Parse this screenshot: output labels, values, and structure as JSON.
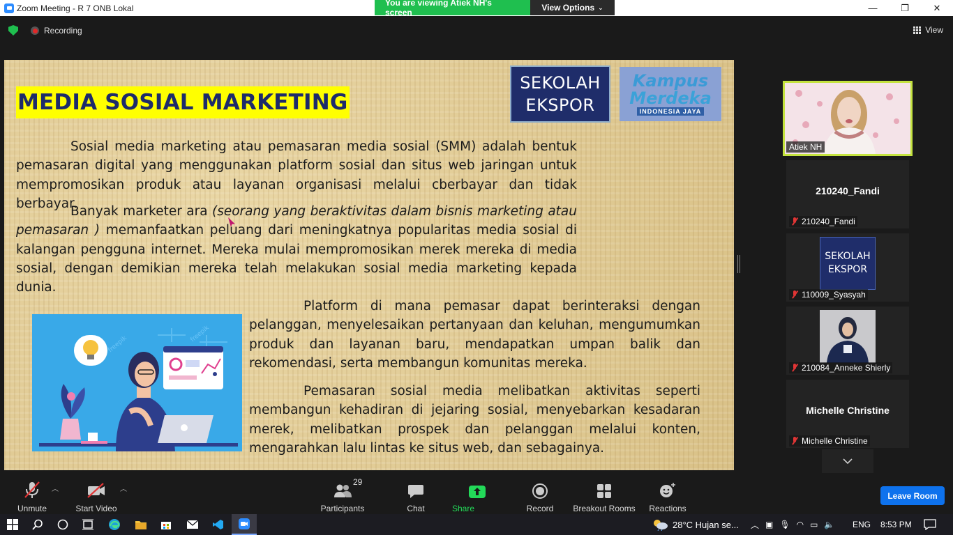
{
  "window": {
    "title": "Zoom Meeting - R 7 ONB Lokal",
    "minimize": "—",
    "maximize": "❐",
    "close": "✕"
  },
  "banner": {
    "viewing_text": "You are viewing Atiek NH's screen",
    "view_options": "View Options"
  },
  "topbar": {
    "recording_label": "Recording",
    "view_label": "View"
  },
  "slide": {
    "title": "MEDIA SOSIAL MARKETING",
    "logo_sekolah_line1": "SEKOLAH",
    "logo_sekolah_line2": "EKSPOR",
    "logo_kampus_line1": "Kampus",
    "logo_kampus_line2": "Merdeka",
    "logo_kampus_line3": "INDONESIA JAYA",
    "p1": "Sosial media marketing atau pemasaran media sosial (SMM) adalah bentuk pemasaran digital yang menggunakan platform sosial dan situs web jaringan untuk mempromosikan produk atau layanan organisasi melalui cberbayar dan tidak berbayar.",
    "p2_start": "Banyak marketer ara ",
    "p2_italic": "(seorang yang beraktivitas dalam bisnis marketing atau pemasaran )",
    "p2_end": " memanfaatkan peluang dari meningkatnya popularitas media sosial di kalangan pengguna internet. Mereka mulai mempromosikan merek mereka di media sosial, dengan demikian mereka telah melakukan sosial media marketing kepada dunia.",
    "p3": "Platform di mana pemasar dapat berinteraksi dengan pelanggan, menyelesaikan pertanyaan dan keluhan, mengumumkan produk dan layanan baru, mendapatkan umpan balik dan rekomendasi, serta membangun komunitas mereka.",
    "p4": "Pemasaran sosial media melibatkan aktivitas seperti membangun kehadiran di jejaring sosial, menyebarkan kesadaran merek, melibatkan prospek dan pelanggan melalui konten, mengarahkan lalu lintas ke situs web, dan sebagainya."
  },
  "gallery": {
    "participants": [
      {
        "name": "Atiek NH",
        "muted": false,
        "video": true
      },
      {
        "name": "210240_Fandi",
        "muted": true,
        "video": false
      },
      {
        "name": "110009_Syasyah",
        "muted": true,
        "video": "logo",
        "logo_line1": "SEKOLAH",
        "logo_line2": "EKSPOR"
      },
      {
        "name": "210084_Anneke Shierly",
        "muted": true,
        "video": true
      },
      {
        "name": "Michelle Christine",
        "muted": true,
        "video": false
      }
    ]
  },
  "toolbar": {
    "unmute": "Unmute",
    "start_video": "Start Video",
    "participants": "Participants",
    "participants_count": "29",
    "chat": "Chat",
    "share_screen": "Share Screen",
    "record": "Record",
    "breakout_rooms": "Breakout Rooms",
    "reactions": "Reactions",
    "leave": "Leave Room"
  },
  "taskbar": {
    "weather": "28°C  Hujan se...",
    "language": "ENG",
    "time": "8:53 PM"
  },
  "colors": {
    "zoom_blue": "#0e72ed",
    "share_green": "#23d959",
    "active_speaker": "#c4e33f",
    "title_highlight": "#ffff00",
    "title_text": "#1d2b6b"
  }
}
